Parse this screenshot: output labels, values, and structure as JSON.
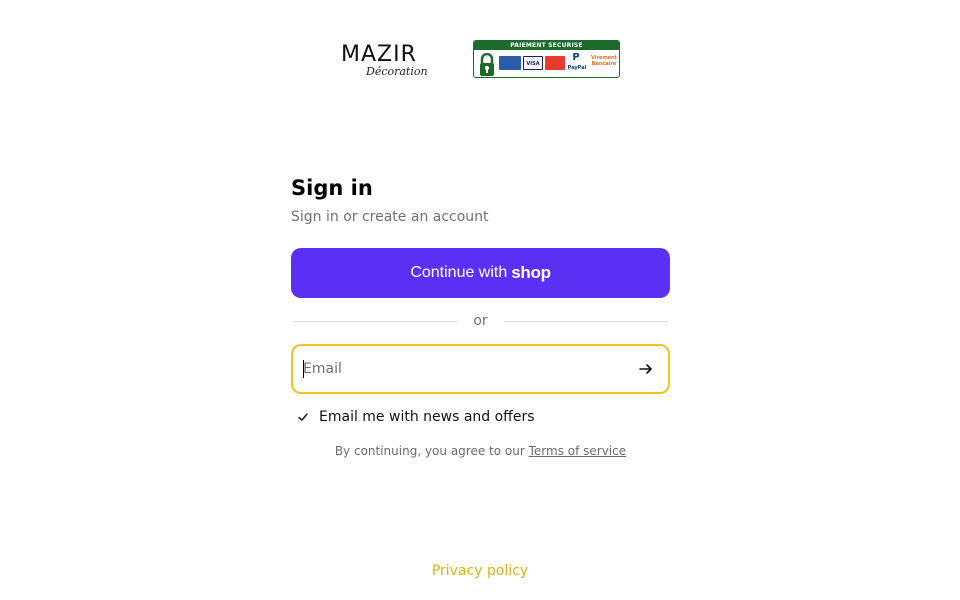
{
  "header": {
    "logo_main": "MAZIR",
    "logo_sub": "Décoration",
    "badge": {
      "title": "PAIEMENT SECURISE",
      "card1": "",
      "card2": "VISA",
      "card3": "",
      "card4": "P",
      "card4_sub": "PayPal",
      "card5": "Virement Bancaire"
    }
  },
  "signin": {
    "title": "Sign in",
    "subtitle": "Sign in or create an account",
    "shop_button_prefix": "Continue with",
    "shop_button_brand": "shop",
    "divider_text": "or",
    "email_placeholder": "Email",
    "email_value": "",
    "newsletter_checked": true,
    "newsletter_label": "Email me with news and offers",
    "terms_prefix": "By continuing, you agree to our",
    "terms_link": "Terms of service"
  },
  "footer": {
    "privacy_link": "Privacy policy"
  },
  "colors": {
    "shop_purple": "#5a31f4",
    "focus_yellow": "#f2c220",
    "privacy_link": "#d8b413",
    "badge_green": "#1d6b2c"
  },
  "icons": {
    "submit": "arrow-right-icon",
    "checkbox": "checkmark-icon",
    "lock": "lock-icon"
  }
}
